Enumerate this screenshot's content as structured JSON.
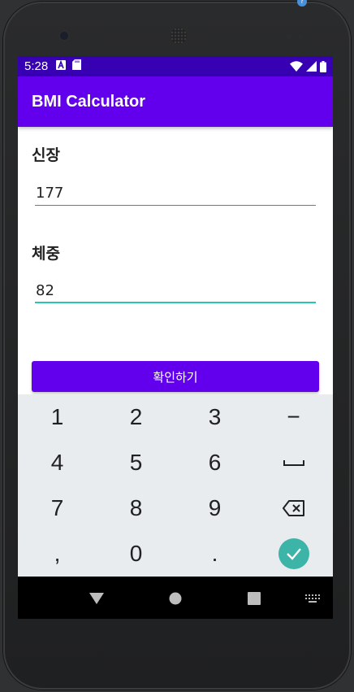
{
  "status_bar": {
    "time": "5:28",
    "icons": [
      "a-notification-icon",
      "sd-card-icon",
      "wifi-icon",
      "signal-icon",
      "battery-icon"
    ]
  },
  "app_bar": {
    "title": "BMI Calculator"
  },
  "form": {
    "height_label": "신장",
    "height_value": "177",
    "weight_label": "체중",
    "weight_value": "82",
    "confirm_label": "확인하기"
  },
  "keyboard": {
    "keys": [
      "1",
      "2",
      "3",
      "−",
      "4",
      "5",
      "6",
      "␣",
      "7",
      "8",
      "9",
      "⌫",
      ",",
      "0",
      ".",
      "✓"
    ]
  },
  "colors": {
    "status_bar": "#3700b3",
    "primary": "#6200ee",
    "focus_underline": "#26c6b0",
    "done_key": "#3cb4a8"
  }
}
